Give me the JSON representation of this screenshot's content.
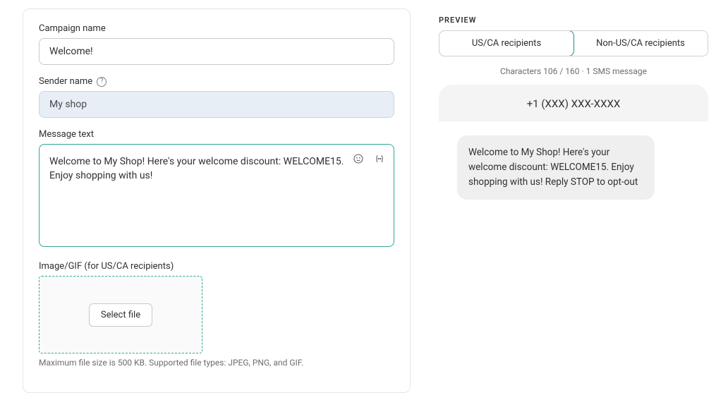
{
  "form": {
    "campaign_name_label": "Campaign name",
    "campaign_name_value": "Welcome!",
    "sender_name_label": "Sender name",
    "sender_name_value": "My shop",
    "message_text_label": "Message text",
    "message_text_value": "Welcome to My Shop! Here's your welcome discount: WELCOME15. Enjoy shopping with us!",
    "image_label": "Image/GIF (for US/CA recipients)",
    "select_file_label": "Select file",
    "image_helper": "Maximum file size is 500 KB. Supported file types: JPEG, PNG, and GIF."
  },
  "preview": {
    "heading": "PREVIEW",
    "tab_us": "US/CA recipients",
    "tab_non_us": "Non-US/CA recipients",
    "char_count": "Characters 106 / 160 · 1 SMS message",
    "phone_number": "+1 (XXX) XXX-XXXX",
    "sms_text": "Welcome to My Shop! Here's your welcome discount: WELCOME15. Enjoy shopping with us! Reply STOP to opt-out"
  }
}
